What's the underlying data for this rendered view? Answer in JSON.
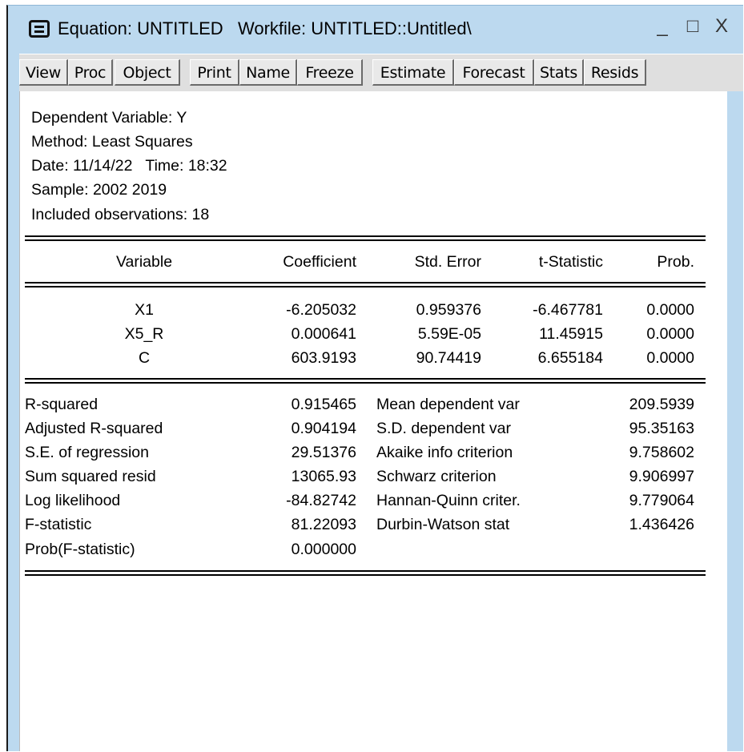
{
  "window": {
    "title": "Equation: UNTITLED   Workfile: UNTITLED::Untitled\\",
    "controls": {
      "minimize": "_",
      "maximize": "□",
      "close": "X"
    }
  },
  "toolbar": [
    "View",
    "Proc",
    "Object",
    "Print",
    "Name",
    "Freeze",
    "Estimate",
    "Forecast",
    "Stats",
    "Resids"
  ],
  "header": {
    "dependent": "Dependent Variable: Y",
    "method": "Method: Least Squares",
    "date": "Date: 11/14/22   Time: 18:32",
    "sample": "Sample: 2002 2019",
    "observations": "Included observations: 18"
  },
  "coef_table": {
    "columns": [
      "Variable",
      "Coefficient",
      "Std. Error",
      "t-Statistic",
      "Prob."
    ],
    "rows": [
      [
        "X1",
        "-6.205032",
        "0.959376",
        "-6.467781",
        "0.0000"
      ],
      [
        "X5_R",
        "0.000641",
        "5.59E-05",
        "11.45915",
        "0.0000"
      ],
      [
        "C",
        "603.9193",
        "90.74419",
        "6.655184",
        "0.0000"
      ]
    ]
  },
  "stats": {
    "left": [
      [
        "R-squared",
        "0.915465"
      ],
      [
        "Adjusted R-squared",
        "0.904194"
      ],
      [
        "S.E. of regression",
        "29.51376"
      ],
      [
        "Sum squared resid",
        "13065.93"
      ],
      [
        "Log likelihood",
        "-84.82742"
      ],
      [
        "F-statistic",
        "81.22093"
      ],
      [
        "Prob(F-statistic)",
        "0.000000"
      ]
    ],
    "right": [
      [
        "Mean dependent var",
        "209.5939"
      ],
      [
        "S.D. dependent var",
        "95.35163"
      ],
      [
        "Akaike info criterion",
        "9.758602"
      ],
      [
        "Schwarz criterion",
        "9.906997"
      ],
      [
        "Hannan-Quinn criter.",
        "9.779064"
      ],
      [
        "Durbin-Watson stat",
        "1.436426"
      ]
    ]
  }
}
